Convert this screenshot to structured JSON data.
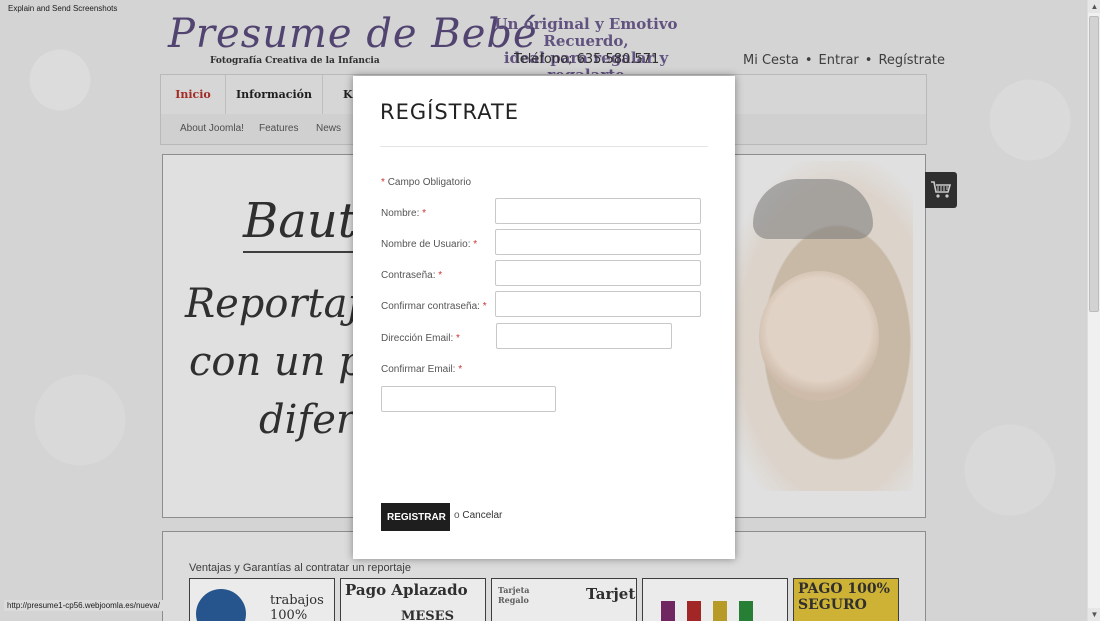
{
  "tool_label": "Explain and Send Screenshots",
  "header": {
    "logo_main": "Presume de Bebé",
    "logo_sub": "Fotografía Creativa de la Infancia",
    "tagline_line1": "Un original y Emotivo Recuerdo,",
    "tagline_line2": "ideal para regalar y regalarte",
    "phone": "Teléfono; 635.580.571",
    "links": [
      "Mi Cesta",
      "Entrar",
      "Regístrate"
    ],
    "link_separator": "•"
  },
  "nav": {
    "items": [
      "Inicio",
      "Información",
      "K"
    ],
    "active_color": "#b0302a",
    "sub_items": [
      "About Joomla!",
      "Features",
      "News"
    ]
  },
  "banner": {
    "title": "Bautiz",
    "lines": [
      "Reportaje trad",
      "con un punto d",
      "diferente"
    ]
  },
  "bottom": {
    "title": "Ventajas y Garantías al contratar un reportaje",
    "badges": [
      "trabajos 100%",
      "Pago Aplazado",
      "Tarjeta",
      "",
      "PAGO 100% SEGURO"
    ],
    "badge_meses": "MESES",
    "badge_tarjeta_small": "Tarjeta Regalo"
  },
  "status_url": "http://presume1-cp56.webjoomla.es/nueva/",
  "modal": {
    "title": "REGÍSTRATE",
    "required_note": "Campo Obligatorio",
    "required_mark": "*",
    "fields": {
      "name_label": "Nombre:",
      "username_label": "Nombre de Usuario:",
      "password_label": "Contraseña:",
      "password2_label": "Confirmar contraseña:",
      "email_label": "Dirección Email:",
      "email2_label": "Confirmar Email:"
    },
    "register_button": "REGISTRAR",
    "or_text": "o",
    "cancel_link": "Cancelar"
  }
}
